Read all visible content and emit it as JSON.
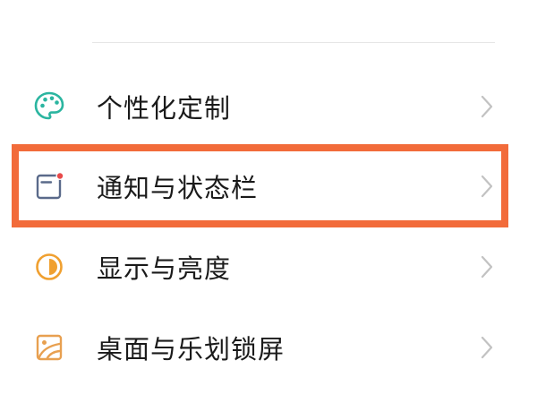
{
  "settings": {
    "items": [
      {
        "label": "个性化定制",
        "icon": "palette-icon"
      },
      {
        "label": "通知与状态栏",
        "icon": "notification-window-icon"
      },
      {
        "label": "显示与亮度",
        "icon": "brightness-half-icon"
      },
      {
        "label": "桌面与乐划锁屏",
        "icon": "wallpaper-icon"
      }
    ]
  },
  "colors": {
    "palette_icon": "#2bb5a0",
    "notification_icon": "#5a6a8a",
    "notification_dot": "#e84a4a",
    "brightness_icon": "#f0a030",
    "wallpaper_icon": "#e8a050",
    "highlight": "#f26b3a",
    "chevron": "#c2c2c2",
    "divider": "#e6e6e6"
  }
}
